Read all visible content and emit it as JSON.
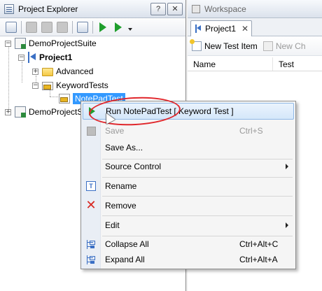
{
  "project_explorer": {
    "title": "Project Explorer",
    "help_label": "?",
    "close_label": "✕",
    "tree": {
      "suite1": "DemoProjectSuite",
      "project1": "Project1",
      "advanced": "Advanced",
      "keyword_tests": "KeywordTests",
      "notepad_test": "NotePadTest",
      "suite2": "DemoProjectSu"
    }
  },
  "workspace": {
    "title": "Workspace",
    "tab_label": "Project1",
    "tab_close": "✕",
    "new_test_item": "New Test Item",
    "new_ch": "New Ch",
    "columns": [
      "Name",
      "Test"
    ]
  },
  "context_menu": {
    "run": "Run NotePadTest [ Keyword Test ]",
    "save": "Save",
    "save_shortcut": "Ctrl+S",
    "save_as": "Save As...",
    "source_control": "Source Control",
    "rename": "Rename",
    "remove": "Remove",
    "edit": "Edit",
    "collapse_all": "Collapse All",
    "collapse_shortcut": "Ctrl+Alt+C",
    "expand_all": "Expand All",
    "expand_shortcut": "Ctrl+Alt+A"
  },
  "colors": {
    "selection": "#3399ff",
    "highlight_ring": "#e0262b",
    "run_green": "#1f9e2d"
  }
}
